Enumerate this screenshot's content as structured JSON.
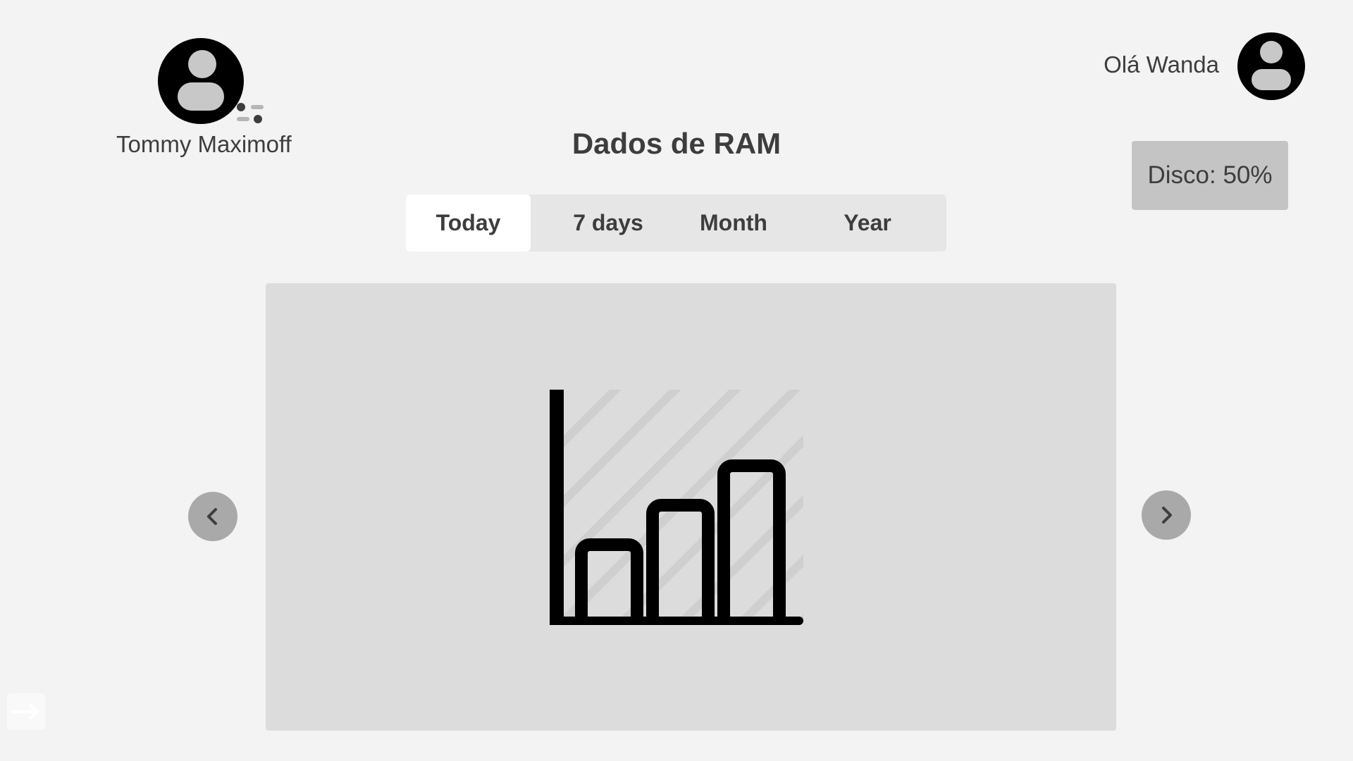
{
  "user": {
    "name": "Tommy Maximoff",
    "avatar_icon": "user-avatar-icon",
    "settings_icon": "sliders-icon"
  },
  "header": {
    "greeting": "Olá Wanda",
    "avatar_icon": "user-avatar-icon"
  },
  "page": {
    "title": "Dados de RAM"
  },
  "disk": {
    "label": "Disco: 50%"
  },
  "tabs": [
    {
      "label": "Today",
      "active": true
    },
    {
      "label": "7 days",
      "active": false
    },
    {
      "label": "Month",
      "active": false
    },
    {
      "label": "Year",
      "active": false
    }
  ],
  "chart_placeholder": {
    "icon": "bar-chart-icon"
  },
  "navigation": {
    "prev_icon": "chevron-left-icon",
    "next_icon": "chevron-right-icon"
  },
  "logout": {
    "icon": "logout-arrow-icon"
  },
  "colors": {
    "background": "#f3f3f3",
    "panel": "#dcdcdc",
    "badge": "#c4c4c4",
    "nav_button": "#a9a9a9",
    "text": "#3d3d3d",
    "tab_active": "#ffffff",
    "tab_bar": "#e6e6e6"
  }
}
